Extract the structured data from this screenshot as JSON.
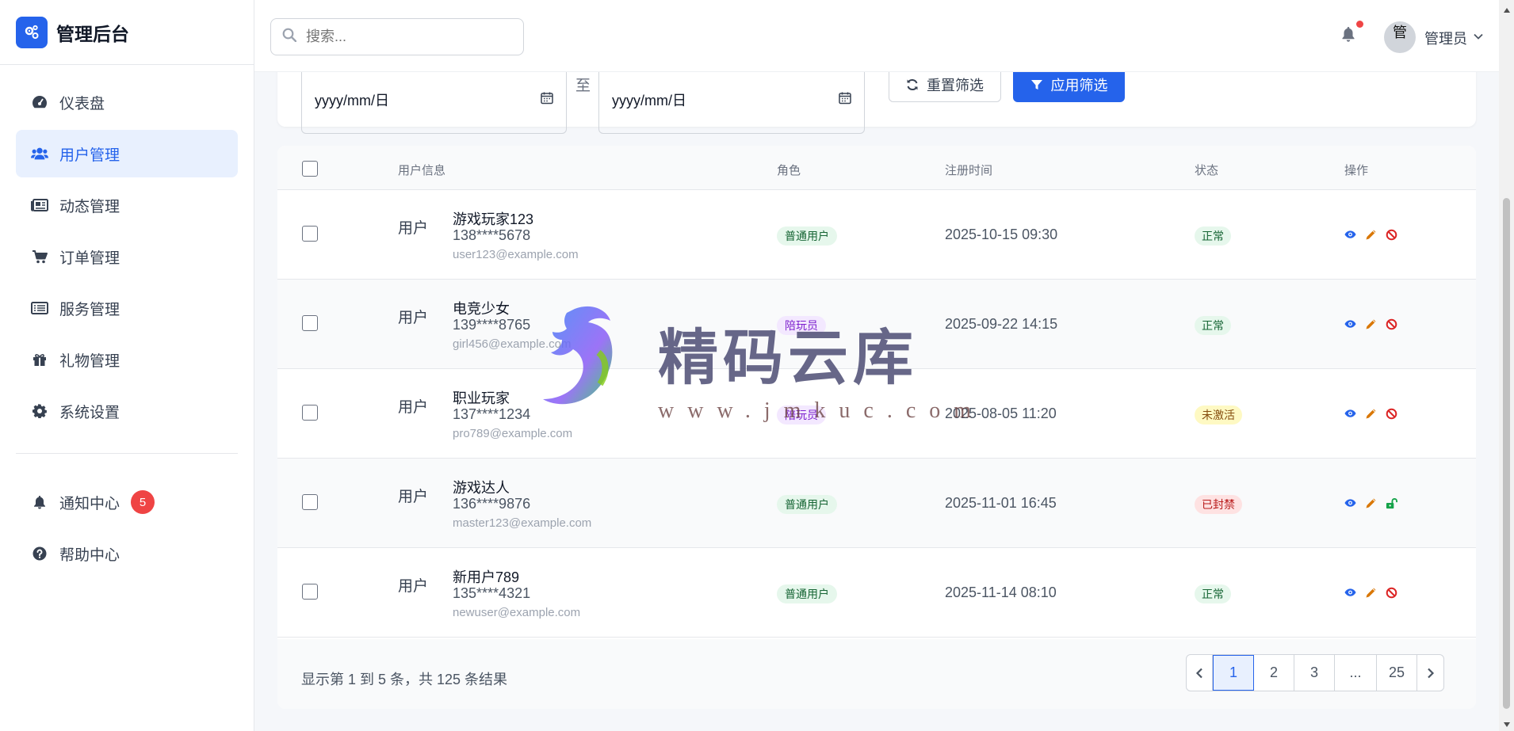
{
  "brand": {
    "title": "管理后台"
  },
  "sidebar": {
    "items": [
      {
        "label": "仪表盘",
        "icon": "dashboard-icon",
        "active": false
      },
      {
        "label": "用户管理",
        "icon": "users-icon",
        "active": true
      },
      {
        "label": "动态管理",
        "icon": "newspaper-icon",
        "active": false
      },
      {
        "label": "订单管理",
        "icon": "cart-icon",
        "active": false
      },
      {
        "label": "服务管理",
        "icon": "list-icon",
        "active": false
      },
      {
        "label": "礼物管理",
        "icon": "gift-icon",
        "active": false
      },
      {
        "label": "系统设置",
        "icon": "gear-icon",
        "active": false
      }
    ],
    "notification": {
      "label": "通知中心",
      "count": "5"
    },
    "help": {
      "label": "帮助中心"
    }
  },
  "header": {
    "search_placeholder": "搜索...",
    "avatar_alt": "管",
    "admin_name": "管理员"
  },
  "filters": {
    "date_start": "yyyy/mm/日",
    "date_to": "至",
    "date_end": "yyyy/mm/日",
    "reset_label": "重置筛选",
    "apply_label": "应用筛选"
  },
  "table": {
    "headers": {
      "user": "用户信息",
      "role": "角色",
      "registered": "注册时间",
      "status": "状态",
      "actions": "操作"
    },
    "avatar_alt": "用户",
    "rows": [
      {
        "name": "游戏玩家123",
        "phone": "138****5678",
        "email": "user123@example.com",
        "role": "普通用户",
        "registered": "2025-10-15 09:30",
        "status": "正常"
      },
      {
        "name": "电竞少女",
        "phone": "139****8765",
        "email": "girl456@example.com",
        "role": "陪玩员",
        "registered": "2025-09-22 14:15",
        "status": "正常"
      },
      {
        "name": "职业玩家",
        "phone": "137****1234",
        "email": "pro789@example.com",
        "role": "陪玩员",
        "registered": "2025-08-05 11:20",
        "status": "未激活"
      },
      {
        "name": "游戏达人",
        "phone": "136****9876",
        "email": "master123@example.com",
        "role": "普通用户",
        "registered": "2025-11-01 16:45",
        "status": "已封禁"
      },
      {
        "name": "新用户789",
        "phone": "135****4321",
        "email": "newuser@example.com",
        "role": "普通用户",
        "registered": "2025-11-14 08:10",
        "status": "正常"
      }
    ]
  },
  "pagination": {
    "info": "显示第 1 到 5 条，共 125 条结果",
    "pages": [
      "1",
      "2",
      "3",
      "...",
      "25"
    ],
    "current": "1"
  },
  "watermark": {
    "title": "精码云库",
    "url": "www.jmkuc.com"
  },
  "colors": {
    "primary": "#2563eb",
    "danger": "#ef4444",
    "success": "#16a34a",
    "warning": "#d97706"
  }
}
